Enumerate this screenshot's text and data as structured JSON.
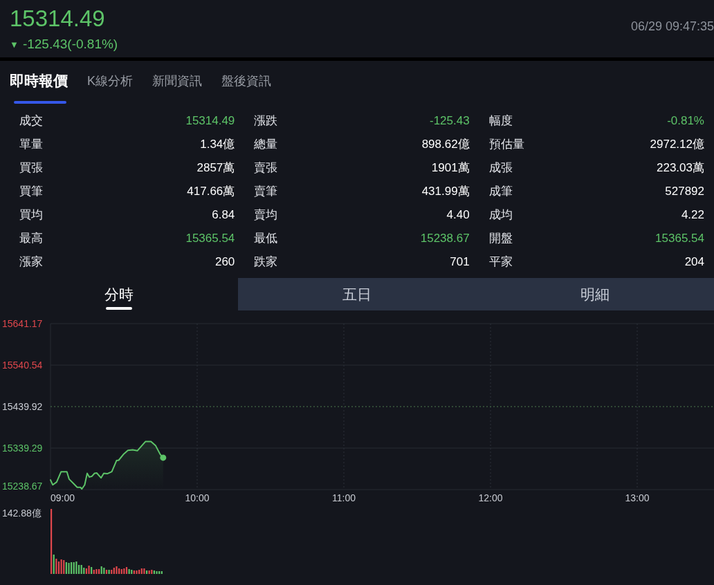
{
  "quote": {
    "price": "15314.49",
    "trend_icon": "▼",
    "change": "-125.43(-0.81%)",
    "time": "06/29 09:47:35"
  },
  "tabs": [
    {
      "label": "即時報價",
      "selected": true
    },
    {
      "label": "K線分析",
      "selected": false
    },
    {
      "label": "新聞資訊",
      "selected": false
    },
    {
      "label": "盤後資訊",
      "selected": false
    }
  ],
  "stats": [
    [
      {
        "label": "成交",
        "value": "15314.49",
        "color": "#5dc468"
      },
      {
        "label": "漲跌",
        "value": "-125.43",
        "color": "#5dc468"
      },
      {
        "label": "幅度",
        "value": "-0.81%",
        "color": "#5dc468"
      }
    ],
    [
      {
        "label": "單量",
        "value": "1.34億",
        "color": "#ffffff"
      },
      {
        "label": "總量",
        "value": "898.62億",
        "color": "#ffffff"
      },
      {
        "label": "預估量",
        "value": "2972.12億",
        "color": "#ffffff"
      }
    ],
    [
      {
        "label": "買張",
        "value": "2857萬",
        "color": "#ffffff"
      },
      {
        "label": "賣張",
        "value": "1901萬",
        "color": "#ffffff"
      },
      {
        "label": "成張",
        "value": "223.03萬",
        "color": "#ffffff"
      }
    ],
    [
      {
        "label": "買筆",
        "value": "417.66萬",
        "color": "#ffffff"
      },
      {
        "label": "賣筆",
        "value": "431.99萬",
        "color": "#ffffff"
      },
      {
        "label": "成筆",
        "value": "527892",
        "color": "#ffffff"
      }
    ],
    [
      {
        "label": "買均",
        "value": "6.84",
        "color": "#ffffff"
      },
      {
        "label": "賣均",
        "value": "4.40",
        "color": "#ffffff"
      },
      {
        "label": "成均",
        "value": "4.22",
        "color": "#ffffff"
      }
    ],
    [
      {
        "label": "最高",
        "value": "15365.54",
        "color": "#5dc468"
      },
      {
        "label": "最低",
        "value": "15238.67",
        "color": "#5dc468"
      },
      {
        "label": "開盤",
        "value": "15365.54",
        "color": "#5dc468"
      }
    ],
    [
      {
        "label": "漲家",
        "value": "260",
        "color": "#ffffff"
      },
      {
        "label": "跌家",
        "value": "701",
        "color": "#ffffff"
      },
      {
        "label": "平家",
        "value": "204",
        "color": "#ffffff"
      }
    ]
  ],
  "chart_tabs": [
    {
      "label": "分時",
      "selected": true
    },
    {
      "label": "五日",
      "selected": false
    },
    {
      "label": "明細",
      "selected": false
    }
  ],
  "chart": {
    "chart_data": {
      "type": "area",
      "grid": true,
      "ref_lines": [
        {
          "axis": "y",
          "value": 15439.92,
          "color": "#4c7a4f"
        }
      ],
      "x": [
        9,
        9.015,
        9.042,
        9.072,
        9.112,
        9.127,
        9.158,
        9.182,
        9.205,
        9.213,
        9.233,
        9.25,
        9.265,
        9.283,
        9.3,
        9.315,
        9.345,
        9.363,
        9.387,
        9.418,
        9.45,
        9.465,
        9.497,
        9.528,
        9.56,
        9.592,
        9.647,
        9.685,
        9.717,
        9.748,
        9.768
      ],
      "series": [
        {
          "color": "#5dc468",
          "values": [
            15262,
            15250,
            15257,
            15282,
            15282,
            15264,
            15253,
            15244,
            15244,
            15240,
            15250,
            15278,
            15269,
            15271,
            15278,
            15279,
            15267,
            15278,
            15277,
            15282,
            15309,
            15310,
            15324,
            15334,
            15335,
            15333,
            15355,
            15355,
            15345,
            15324,
            15316
          ]
        }
      ],
      "xlim": [
        9,
        13.5
      ],
      "ylim": [
        15238.67,
        15641.17
      ],
      "xticks": [
        {
          "value": 9,
          "label": "09:00"
        },
        {
          "value": 10,
          "label": "10:00"
        },
        {
          "value": 11,
          "label": "11:00"
        },
        {
          "value": 12,
          "label": "12:00"
        },
        {
          "value": 13,
          "label": "13:00"
        }
      ],
      "yticks": [
        15641.17,
        15540.54,
        15439.92,
        15339.29,
        15238.67
      ]
    }
  },
  "volume": {
    "max_label": "142.88億"
  }
}
